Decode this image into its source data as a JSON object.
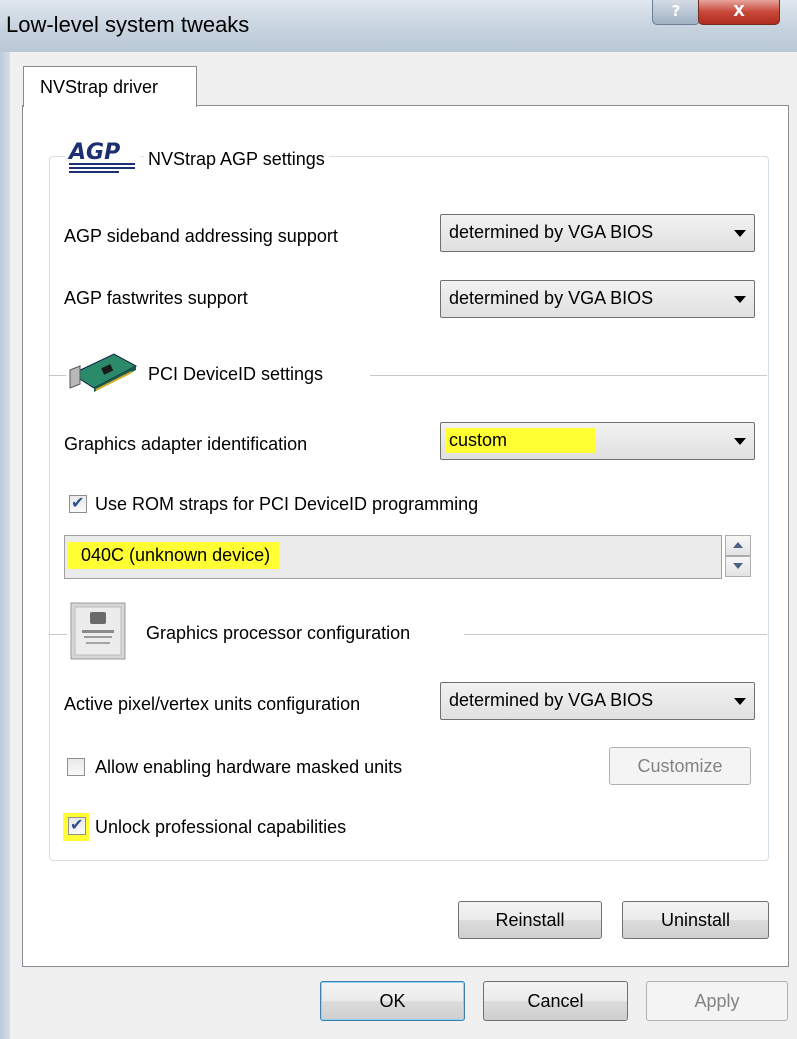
{
  "window": {
    "title": "Low-level system tweaks",
    "help_label": "?",
    "close_label": "X"
  },
  "tabs": [
    {
      "label": "NVStrap driver"
    }
  ],
  "agp_section": {
    "logo_text": "AGP",
    "title": "NVStrap AGP settings",
    "sideband_label": "AGP sideband addressing support",
    "sideband_value": "determined by VGA BIOS",
    "fastwrites_label": "AGP fastwrites support",
    "fastwrites_value": "determined by VGA BIOS"
  },
  "pci_section": {
    "title": "PCI DeviceID settings",
    "adapter_label": "Graphics adapter identification",
    "adapter_value": "custom",
    "use_rom_straps_label": "Use ROM straps for PCI DeviceID programming",
    "use_rom_straps_checked": true,
    "device_id_value": "040C (unknown device)"
  },
  "gpu_section": {
    "title": "Graphics processor configuration",
    "units_label": "Active pixel/vertex units configuration",
    "units_value": "determined by VGA BIOS",
    "allow_masked_label": "Allow enabling hardware masked units",
    "allow_masked_checked": false,
    "customize_label": "Customize",
    "unlock_pro_label": "Unlock professional capabilities",
    "unlock_pro_checked": true
  },
  "panel_buttons": {
    "reinstall": "Reinstall",
    "uninstall": "Uninstall"
  },
  "dialog_buttons": {
    "ok": "OK",
    "cancel": "Cancel",
    "apply": "Apply"
  },
  "colors": {
    "highlight": "#ffff33",
    "checkmark": "#2b4f8f"
  },
  "icons": [
    "agp-logo-icon",
    "pci-card-icon",
    "gpu-chip-icon",
    "checkbox-check-icon",
    "dropdown-arrow-icon",
    "spin-up-icon",
    "spin-down-icon"
  ]
}
